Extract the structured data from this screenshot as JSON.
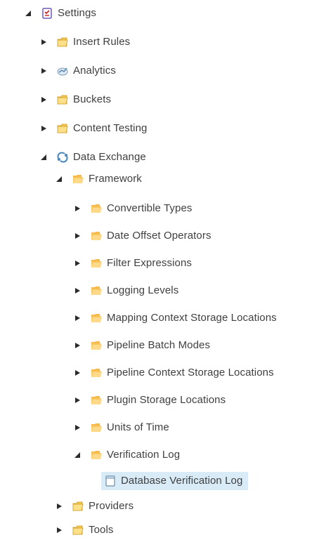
{
  "tree": {
    "root": {
      "label": "Settings",
      "icon": "settings-checklist-icon",
      "expanded": true
    },
    "insert_rules": {
      "label": "Insert Rules",
      "icon": "folder-icon",
      "expanded": false
    },
    "analytics": {
      "label": "Analytics",
      "icon": "analytics-icon",
      "expanded": false
    },
    "buckets": {
      "label": "Buckets",
      "icon": "folder-icon",
      "expanded": false
    },
    "content_testing": {
      "label": "Content Testing",
      "icon": "folder-icon",
      "expanded": false
    },
    "data_exchange": {
      "label": "Data Exchange",
      "icon": "data-exchange-icon",
      "expanded": true
    },
    "framework": {
      "label": "Framework",
      "icon": "open-folder-icon",
      "expanded": true
    },
    "convertible_types": {
      "label": "Convertible Types",
      "icon": "open-folder-icon",
      "expanded": false
    },
    "date_offset_operators": {
      "label": "Date Offset Operators",
      "icon": "open-folder-icon",
      "expanded": false
    },
    "filter_expressions": {
      "label": "Filter Expressions",
      "icon": "open-folder-icon",
      "expanded": false
    },
    "logging_levels": {
      "label": "Logging Levels",
      "icon": "open-folder-icon",
      "expanded": false
    },
    "mapping_context_storage_locations": {
      "label": "Mapping Context Storage Locations",
      "icon": "open-folder-icon",
      "expanded": false
    },
    "pipeline_batch_modes": {
      "label": "Pipeline Batch Modes",
      "icon": "open-folder-icon",
      "expanded": false
    },
    "pipeline_context_storage_locations": {
      "label": "Pipeline Context Storage Locations",
      "icon": "open-folder-icon",
      "expanded": false
    },
    "plugin_storage_locations": {
      "label": "Plugin Storage Locations",
      "icon": "open-folder-icon",
      "expanded": false
    },
    "units_of_time": {
      "label": "Units of Time",
      "icon": "open-folder-icon",
      "expanded": false
    },
    "verification_log": {
      "label": "Verification Log",
      "icon": "open-folder-icon",
      "expanded": true
    },
    "database_verification_log": {
      "label": "Database Verification Log",
      "icon": "document-icon",
      "selected": true
    },
    "providers": {
      "label": "Providers",
      "icon": "folder-icon",
      "expanded": false
    },
    "tools": {
      "label": "Tools",
      "icon": "folder-icon",
      "expanded": false
    }
  },
  "colors": {
    "selected_background": "#d8ebf7",
    "text": "#3f3f3f",
    "toggle": "#2b2b2b",
    "folder": "#f2c94c",
    "open_folder": "#f7c65f"
  }
}
